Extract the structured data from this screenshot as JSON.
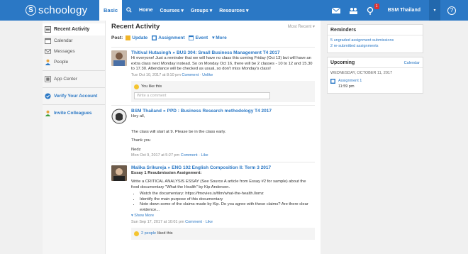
{
  "topbar": {
    "logo_text": "schoology",
    "logo_letter": "S",
    "basic_label": "Basic",
    "nav": [
      "Home",
      "Courses ▾",
      "Groups ▾",
      "Resources ▾"
    ],
    "notification_count": "1",
    "user_name": "BSM Thailand",
    "caret": "▾",
    "help": "?"
  },
  "sidebar": {
    "items": [
      {
        "label": "Recent Activity"
      },
      {
        "label": "Calendar"
      },
      {
        "label": "Messages"
      },
      {
        "label": "People"
      },
      {
        "label": "App Center"
      },
      {
        "label": "Verify Your Account"
      },
      {
        "label": "Invite Colleagues"
      }
    ]
  },
  "main": {
    "title": "Recent Activity",
    "sort_label": "Most Recent ▾",
    "post_label": "Post:",
    "post_options": [
      "Update",
      "Assignment",
      "Event",
      "▾ More"
    ],
    "posts": [
      {
        "author": "Thitival Hutasingh",
        "course": "BUS 304: Small Business Management T4 2017",
        "text": "Hi everyone! Just a reminder that we will have no class this coming Friday (Oct 13) but will have an extra class next Monday instead. So on Monday Oct 16, there will be 2 classes - 10 to 12 and 15.30 to 17.30. Attendance will be checked as usual, so don't miss Monday's class!",
        "date": "Tue Oct 10, 2017 at 8:10 pm",
        "action1": "Comment",
        "action2": "Unlike",
        "likes": "You like this",
        "comment_placeholder": "Write a comment"
      },
      {
        "author": "BSM Thailand",
        "course": "PPD : Business Research methodology T4 2017",
        "greeting": "Hey all,",
        "line1": "The class will start at 9. Please be in the class early.",
        "line2": "Thank you",
        "sign": "Nedz",
        "date": "Mon Oct 9, 2017 at 5:27 pm",
        "action1": "Comment",
        "action2": "Like"
      },
      {
        "author": "Malika Srikureja",
        "course": "ENG 102 English Composition II: Term 3 2017",
        "subtitle": "Essay 1 Resubmission Assignment:",
        "text": "Write a CRITICAL ANALYSIS ESSAY (See Source A article from Essay #2 for sample) about the food documentary \"What the Health\" by Kip Andersen.",
        "bullets": [
          "Watch the documentary: https://fmovies.is/film/what-the-health.llomz",
          "Identify the main purpose of this documentary",
          "Note down some of the claims made by Kip. Do you agree with these claims? Are there clear evidence..."
        ],
        "show_more": "▾ Show More",
        "date": "Sun Sep 17, 2017 at 10:01 pm",
        "action1": "Comment",
        "action2": "Like",
        "likes_link": "2 people",
        "likes_rest": "liked this"
      }
    ]
  },
  "reminders": {
    "title": "Reminders",
    "items": [
      "5 ungraded assignment submissions",
      "2 re-submitted assignments"
    ]
  },
  "upcoming": {
    "title": "Upcoming",
    "calendar_link": "Calendar",
    "date": "WEDNESDAY, OCTOBER 11, 2017",
    "item_title": "Assignment 1",
    "item_time": "11:59 pm"
  },
  "colors": {
    "brand": "#2b78c5",
    "link": "#2b78c5"
  }
}
